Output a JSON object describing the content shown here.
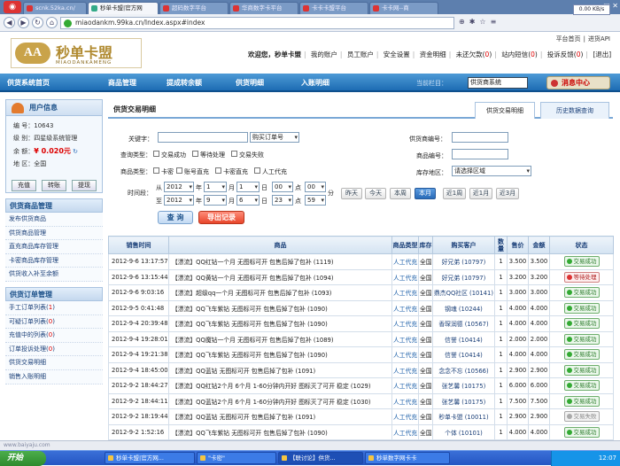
{
  "browser": {
    "tabs": [
      "scnk.52ka.cn/",
      "秒单卡盟|官方网",
      "超码数字平台",
      "华商数字卡平台",
      "卡卡卡盟平台",
      "卡卡网--商"
    ],
    "url": "miaodankm.99ka.cn/Index.aspx#index",
    "speed": "0.00 KB/s"
  },
  "logo": {
    "name": "秒单卡盟",
    "en": "MIAODANKAMENG"
  },
  "toplinks": [
    "平台首页",
    "进货API"
  ],
  "welcome": {
    "greeting": "欢迎您，秒单卡盟",
    "links": [
      "我的账户",
      "员工账户",
      "安全设置",
      "资金明细"
    ],
    "unread_label": "未还欠款",
    "unread_count": "0",
    "inbox_label": "站内短信",
    "inbox_count": "0",
    "complaint_label": "投诉反馈",
    "complaint_count": "0",
    "logout": "[退出]"
  },
  "nav": {
    "items": [
      "供货系统首页",
      "商品管理",
      "提成转余额",
      "供货明细",
      "入账明细"
    ],
    "current_label": "当前栏目：",
    "current_value": "供货商系统",
    "messages": "消息中心"
  },
  "user": {
    "title": "用户信息",
    "id_label": "编 号：",
    "id": "10643",
    "level_label": "级 别：",
    "level": "四星级系统管理",
    "balance_label": "余 额：",
    "balance": "¥ 0.020元",
    "region_label": "地 区：",
    "region": "全国",
    "buttons": [
      "充值",
      "转账",
      "提现"
    ]
  },
  "menu1": {
    "title": "供货商品管理",
    "items": [
      "发布供货商品",
      "供货商品管理",
      "直充商品库存管理",
      "卡密商品库存管理",
      "供货收入补至余额"
    ]
  },
  "menu2": {
    "title": "供货订单管理",
    "items": [
      {
        "label": "手工订单列表",
        "count": "1"
      },
      {
        "label": "可疑订单列表",
        "count": "0"
      },
      {
        "label": "充值中的列表",
        "count": "0"
      },
      {
        "label": "订单投诉处理",
        "count": "0"
      },
      {
        "label": "供货交易明细"
      },
      {
        "label": "销售入账明细"
      }
    ]
  },
  "main": {
    "title": "供货交易明细",
    "tabs": [
      "供货交易明细",
      "历史数据查询"
    ],
    "keyword_label": "关键字：",
    "keyword_select": "购买订单号",
    "query_label": "查询类型：",
    "query_types": [
      "交易成功",
      "等待处理",
      "交易失败"
    ],
    "goods_label": "商品类型：",
    "goods_types": [
      "卡密",
      "账号直充",
      "卡密直充",
      "人工代充"
    ],
    "time_label": "时间段：",
    "from_label": "从",
    "to_label": "至",
    "date_from": {
      "year": "2012",
      "month": "1",
      "day": "1",
      "hour": "00",
      "minute": "00"
    },
    "date_to": {
      "year": "2012",
      "month": "9",
      "day": "6",
      "hour": "23",
      "minute": "59"
    },
    "year_unit": "年",
    "month_unit": "月",
    "day_unit": "日",
    "hour_unit": "点",
    "minute_unit": "分",
    "quick": [
      "昨天",
      "今天",
      "本周",
      "本月",
      "近1周",
      "近1月",
      "近3月"
    ],
    "quick_active": "本月",
    "supply_no_label": "供货商编号：",
    "goods_no_label": "商品编号：",
    "region_label": "库存地区：",
    "region_select": "请选择区域",
    "search_btn": "查 询",
    "export_btn": "导出记录"
  },
  "table": {
    "headers": [
      "销售时间",
      "商品",
      "商品类型",
      "库存",
      "购买客户",
      "数量",
      "售价",
      "金额",
      "状态"
    ],
    "rows": [
      [
        "2012-9-6 13:17:57",
        "【漂流】QQ红钻一个月 无图标可开 包售后掉了包补 (1119)",
        "人工代充",
        "全国",
        "好兄弟 (10797)",
        "1",
        "3.500",
        "3.500",
        "交易成功"
      ],
      [
        "2012-9-6 13:15:44",
        "【漂流】QQ黄钻一个月 无图标可开 包售后掉了包补 (1094)",
        "人工代充",
        "全国",
        "好兄弟 (10797)",
        "1",
        "3.200",
        "3.200",
        "等待处理"
      ],
      [
        "2012-9-6 9:03:16",
        "【漂流】超级qq一个月 无图标可开 包售后掉了包补 (1093)",
        "人工代充",
        "全国",
        "鼎杰QQ社区 (10141)",
        "1",
        "3.000",
        "3.000",
        "交易成功"
      ],
      [
        "2012-9-5 0:41:48",
        "【漂流】QQ飞车紫钻 无图标可开 包售后掉了包补 (1090)",
        "人工代充",
        "全国",
        "钢魂 (10244)",
        "1",
        "4.000",
        "4.000",
        "交易成功"
      ],
      [
        "2012-9-4 20:39:48",
        "【漂流】QQ飞车紫钻 无图标可开 包售后掉了包补 (1090)",
        "人工代充",
        "全国",
        "香琛润德 (10567)",
        "1",
        "4.000",
        "4.000",
        "交易成功"
      ],
      [
        "2012-9-4 19:28:01",
        "【漂流】QQ魔钻一个月 无图标可开 包售后掉了包补 (1089)",
        "人工代充",
        "全国",
        "信誉 (10414)",
        "1",
        "2.000",
        "2.000",
        "交易成功"
      ],
      [
        "2012-9-4 19:21:38",
        "【漂流】QQ飞车紫钻 无图标可开 包售后掉了包补 (1090)",
        "人工代充",
        "全国",
        "信誉 (10414)",
        "1",
        "4.000",
        "4.000",
        "交易成功"
      ],
      [
        "2012-9-4 18:45:00",
        "【漂流】QQ蓝钻 无图标可开 包售后掉了包补 (1091)",
        "人工代充",
        "全国",
        "念念不忘 (10566)",
        "1",
        "2.900",
        "2.900",
        "交易成功"
      ],
      [
        "2012-9-2 18:44:27",
        "【漂流】QQ红钻2个月 6个月 1-60分钟内开好 图标灭了可开 稳定 (1029)",
        "人工代充",
        "全国",
        "张艺馨 (10175)",
        "1",
        "6.000",
        "6.000",
        "交易成功"
      ],
      [
        "2012-9-2 18:44:11",
        "【漂流】QQ蓝钻2个月 6个月 1-60分钟内开好 图标灭了可开 稳定 (1030)",
        "人工代充",
        "全国",
        "张艺馨 (10175)",
        "1",
        "7.500",
        "7.500",
        "交易成功"
      ],
      [
        "2012-9-2 18:19:44",
        "【漂流】QQ蓝钻 无图标可开 包售后掉了包补 (1091)",
        "人工代充",
        "全国",
        "秒单卡盟 (10011)",
        "1",
        "2.900",
        "2.900",
        "交易失败"
      ],
      [
        "2012-9-2 1:52:16",
        "【漂流】QQ飞车紫钻 无图标可开 包售后掉了包补 (1090)",
        "人工代充",
        "全国",
        "个体 (10101)",
        "1",
        "4.000",
        "4.000",
        "交易成功"
      ]
    ]
  },
  "statusbar": "www.baiyaju.com",
  "taskbar": {
    "start": "开始",
    "tasks": [
      "秒单卡盟|官方网...",
      "\"卡密\"",
      "【联讨论】供货...",
      "秒单数字网卡卡"
    ],
    "clock": "12:07"
  }
}
